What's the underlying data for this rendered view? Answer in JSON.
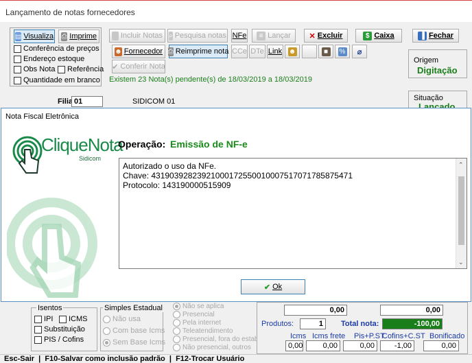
{
  "window": {
    "title": "Lançamento de notas fornecedores"
  },
  "left_panel": {
    "visualiza_label": "Visualiza",
    "imprime_label": "Imprime",
    "checks": [
      "Conferência de preços",
      "Endereço estoque",
      "Obs Nota",
      "Referência",
      "Quantidade em branco"
    ]
  },
  "toolbar": {
    "incluir_notas": "Incluir Notas",
    "pesquisa_notas": "Pesquisa notas",
    "nfe": "NFe",
    "lancar": "Lançar",
    "excluir": "Excluir",
    "caixa": "Caixa",
    "fechar": "Fechar",
    "fornecedor": "Fornecedor",
    "reimprime_nota": "Reimprime nota",
    "cce": "CCe",
    "dte": "DTe",
    "link": "Link",
    "conferir_nota": "Conferir Nota",
    "pending_msg": "Existem 23 Nota(s) pendente(s) de 18/03/2019 a 18/03/2019"
  },
  "origem": {
    "label": "Origem",
    "value": "Digitação"
  },
  "situacao": {
    "label": "Situação",
    "value": "Lançado"
  },
  "filial": {
    "label": "Filial:",
    "code": "01",
    "name": "SIDICOM 01"
  },
  "dialog": {
    "title": "Nota Fiscal Eletrônica",
    "logo_text": "CliqueNota",
    "logo_sub": "Sidicom",
    "operacao_label": "Operação:",
    "operacao_value": "Emissão de NF-e",
    "message_lines": [
      "Autorizado o uso da NFe.",
      "Chave: 43190392823921000172550010007517071785875471",
      "Protocolo: 143190000515909"
    ],
    "ok_label": "Ok"
  },
  "isentos": {
    "title": "Isentos",
    "ipi": "IPI",
    "icms": "ICMS",
    "substituicao": "Substituição",
    "pis_cofins": "PIS / Cofins"
  },
  "simples": {
    "title": "Simples Estadual",
    "options": [
      "Não usa",
      "Com base Icms",
      "Sem Base Icms"
    ],
    "selected": "Sem Base Icms"
  },
  "presenca": {
    "options": [
      "Não se aplica",
      "Presencial",
      "Pela internet",
      "Teleatendimento",
      "Presencial, fora do estabel",
      "Não presencial, outros"
    ]
  },
  "totals": {
    "field1": "0,00",
    "field2": "0,00",
    "produtos_label": "Produtos:",
    "produtos_value": "1",
    "total_nota_label": "Total nota:",
    "total_nota_value": "-100,00",
    "cols": [
      "Icms",
      "Icms frete",
      "Pis+P.ST",
      "Cofins+C.ST",
      "Bonificado"
    ],
    "values": [
      "0,00",
      "0,00",
      "0,00",
      "-1,00",
      "0,00"
    ]
  },
  "status_bar": {
    "text": "Esc-Sair  |  F10-Salvar como inclusão padrão  |  F12-Trocar Usuário"
  }
}
